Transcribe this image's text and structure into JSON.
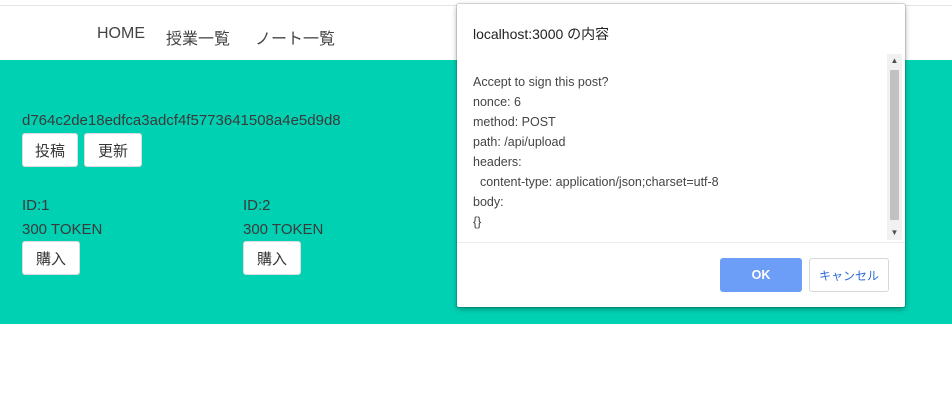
{
  "nav": {
    "items": [
      {
        "label": "HOME"
      },
      {
        "label": "授業一覧"
      },
      {
        "label": "ノート一覧"
      }
    ]
  },
  "account": {
    "address": "d764c2de18edfca3adcf4f5773641508a4e5d9d8",
    "post_label": "投稿",
    "refresh_label": "更新"
  },
  "cards": [
    {
      "id": "ID:1",
      "price": "300 TOKEN",
      "buy_label": "購入"
    },
    {
      "id": "ID:2",
      "price": "300 TOKEN",
      "buy_label": "購入"
    }
  ],
  "dialog": {
    "title": "localhost:3000 の内容",
    "message": "Accept to sign this post?\nnonce: 6\nmethod: POST\npath: /api/upload\nheaders:\n  content-type: application/json;charset=utf-8\nbody:\n{}",
    "ok_label": "OK",
    "cancel_label": "キャンセル"
  },
  "colors": {
    "hero": "#00d1b2",
    "ok_button": "#6c9ef8",
    "cancel_text": "#2f6bd6"
  }
}
